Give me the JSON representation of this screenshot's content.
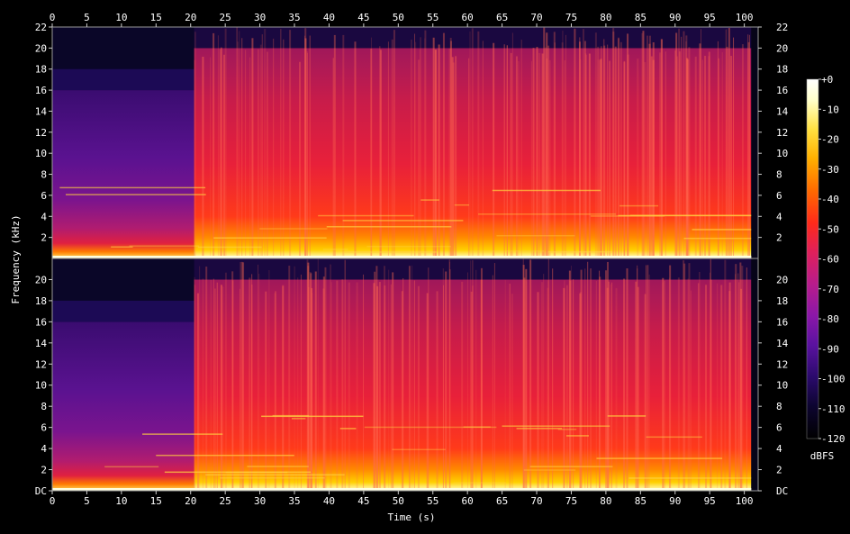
{
  "chart_data": {
    "type": "heatmap",
    "subtype": "spectrogram",
    "title": "",
    "xlabel": "Time (s)",
    "ylabel": "Frequency (kHz)",
    "xlim": [
      0,
      102
    ],
    "ylim": [
      0,
      22
    ],
    "x_ticks": [
      0,
      5,
      10,
      15,
      20,
      25,
      30,
      35,
      40,
      45,
      50,
      55,
      60,
      65,
      70,
      75,
      80,
      85,
      90,
      95,
      100
    ],
    "y_ticks": [
      2,
      4,
      6,
      8,
      10,
      12,
      14,
      16,
      18,
      20,
      22
    ],
    "y_tick_labels_bottom_panel": [
      "DC",
      "2",
      "4",
      "6",
      "8",
      "10",
      "12",
      "14",
      "16",
      "18",
      "20"
    ],
    "channels": [
      "top",
      "bottom"
    ],
    "colorbar": {
      "label": "dBFS",
      "ticks": [
        "+0",
        "-10",
        "-20",
        "-30",
        "-40",
        "-50",
        "-60",
        "-70",
        "-80",
        "-90",
        "-100",
        "-110",
        "-120"
      ],
      "range": [
        -120,
        0
      ],
      "colors": [
        "#000000",
        "#0d0530",
        "#2a0a6b",
        "#5a12a0",
        "#8a17a8",
        "#b81c8c",
        "#e0205a",
        "#ff2a1a",
        "#ff6a00",
        "#ffb000",
        "#ffe040",
        "#ffffc8",
        "#ffffff"
      ]
    },
    "segments": [
      {
        "t_start": 0,
        "t_end": 20.5,
        "cutoff_khz": 16,
        "level": "quiet"
      },
      {
        "t_start": 20.5,
        "t_end": 101,
        "cutoff_khz": 20,
        "level": "loud"
      }
    ],
    "audio_end_s": 101
  }
}
